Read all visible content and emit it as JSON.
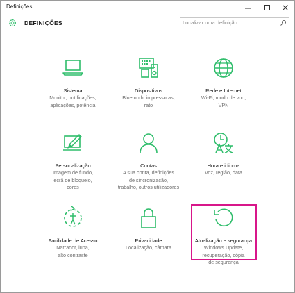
{
  "window": {
    "title": "Definições",
    "minimize_glyph": "—",
    "maximize_glyph": "☐",
    "close_glyph": "✕"
  },
  "header": {
    "page_title": "DEFINIÇÕES",
    "search_placeholder": "Localizar uma definição"
  },
  "accent_color": "#2fbd6b",
  "highlight_color": "#d8168a",
  "tiles": [
    {
      "icon": "laptop-icon",
      "label": "Sistema",
      "desc": [
        "Monitor, notificações,",
        "aplicações, potência"
      ]
    },
    {
      "icon": "devices-icon",
      "label": "Dispositivos",
      "desc": [
        "Bluetooth, impressoras,",
        "rato"
      ]
    },
    {
      "icon": "globe-icon",
      "label": "Rede e Internet",
      "desc": [
        "Wi-Fi, modo de voo,",
        "VPN"
      ]
    },
    {
      "icon": "personalization-icon",
      "label": "Personalização",
      "desc": [
        "Imagem de fundo,",
        "ecrã de bloqueio,",
        "cores"
      ]
    },
    {
      "icon": "person-icon",
      "label": "Contas",
      "desc": [
        "A sua conta, definições",
        "de sincronização,",
        "trabalho, outros utilizadores"
      ]
    },
    {
      "icon": "time-language-icon",
      "label": "Hora e idioma",
      "desc": [
        "Voz, região, data"
      ]
    },
    {
      "icon": "ease-of-access-icon",
      "label": "Facilidade de Acesso",
      "desc": [
        "Narrador, lupa,",
        "alto contraste"
      ]
    },
    {
      "icon": "lock-icon",
      "label": "Privacidade",
      "desc": [
        "Localização, câmara"
      ]
    },
    {
      "icon": "refresh-icon",
      "label": "Atualização e segurança",
      "desc": [
        "Windows Update,",
        "recuperação, cópia",
        "de segurança"
      ]
    }
  ]
}
